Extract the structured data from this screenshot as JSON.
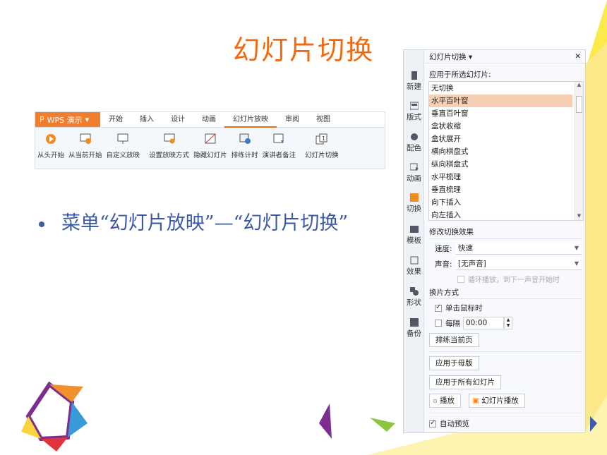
{
  "slide": {
    "title": "幻灯片切换",
    "bullet": "菜单“幻灯片放映”—“幻灯片切换”"
  },
  "ribbon": {
    "app_button": "WPS 演示",
    "tabs": [
      "开始",
      "插入",
      "设计",
      "动画",
      "幻灯片放映",
      "审阅",
      "视图"
    ],
    "active_tab": "幻灯片放映",
    "tools": [
      "从头开始",
      "从当前开始",
      "自定义放映",
      "设置放映方式",
      "隐藏幻灯片",
      "排练计时",
      "演讲者备注",
      "幻灯片切换"
    ]
  },
  "pane": {
    "title": "幻灯片切换",
    "apply_label": "应用于所选幻灯片:",
    "sidebar": [
      "新建",
      "版式",
      "配色",
      "动画",
      "切换",
      "模板",
      "效果",
      "形状",
      "备份"
    ],
    "transitions": [
      "无切换",
      "水平百叶窗",
      "垂直百叶窗",
      "盒状收缩",
      "盒状展开",
      "横向棋盘式",
      "纵向棋盘式",
      "水平梳理",
      "垂直梳理",
      "向下插入",
      "向左插入"
    ],
    "selected_transition": "水平百叶窗",
    "modify_label": "修改切换效果",
    "speed_label": "速度:",
    "speed_value": "快速",
    "sound_label": "声音:",
    "sound_value": "[无声音]",
    "loop_label": "循环播放，到下一声音开始时",
    "advance_label": "换片方式",
    "on_click_label": "单击鼠标时",
    "every_label": "每隔",
    "every_value": "00:00",
    "rehearse_btn": "排练当前页",
    "apply_master_btn": "应用于母版",
    "apply_all_btn": "应用于所有幻灯片",
    "play_btn": "播放",
    "slideshow_btn": "幻灯片播放",
    "autopreview_label": "自动预览"
  },
  "colors": {
    "accent": "#f26a10",
    "bullet": "#3b5aa5",
    "selection": "#f6cfb5"
  }
}
